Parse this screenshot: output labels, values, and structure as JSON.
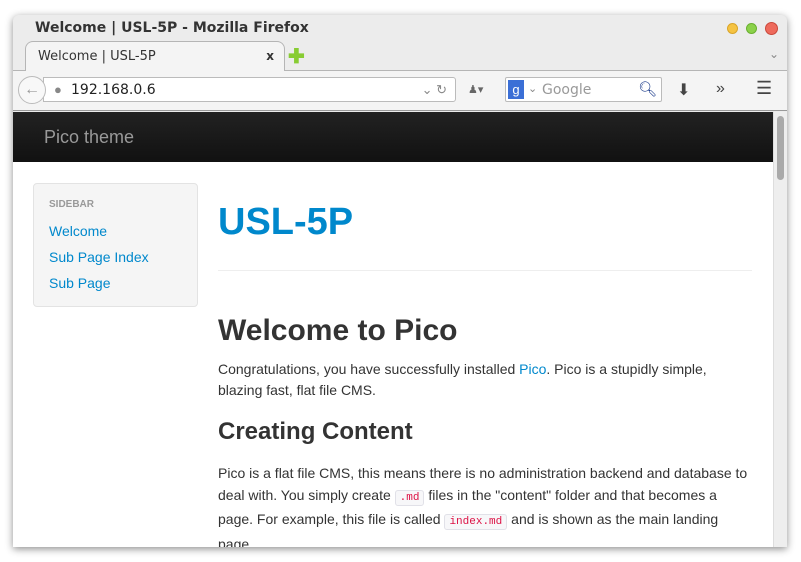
{
  "window": {
    "title": "Welcome | USL-5P - Mozilla Firefox"
  },
  "tab": {
    "label": "Welcome | USL-5P",
    "close": "x"
  },
  "nav": {
    "url": "192.168.0.6",
    "search_placeholder": "Google"
  },
  "site": {
    "brand": "Pico theme"
  },
  "sidebar": {
    "heading": "SIDEBAR",
    "items": [
      {
        "label": "Welcome"
      },
      {
        "label": "Sub Page Index"
      },
      {
        "label": "Sub Page"
      }
    ]
  },
  "main": {
    "title": "USL-5P",
    "h_welcome": "Welcome to Pico",
    "p1_a": "Congratulations, you have successfully installed ",
    "p1_link": "Pico",
    "p1_b": ". Pico is a stupidly simple, blazing fast, flat file CMS.",
    "h_creating": "Creating Content",
    "p2_a": "Pico is a flat file CMS, this means there is no administration backend and database to deal with. You simply create ",
    "p2_code1": ".md",
    "p2_b": " files in the \"content\" folder and that becomes a page. For example, this file is called ",
    "p2_code2": "index.md",
    "p2_c": " and is shown as the main landing page."
  }
}
